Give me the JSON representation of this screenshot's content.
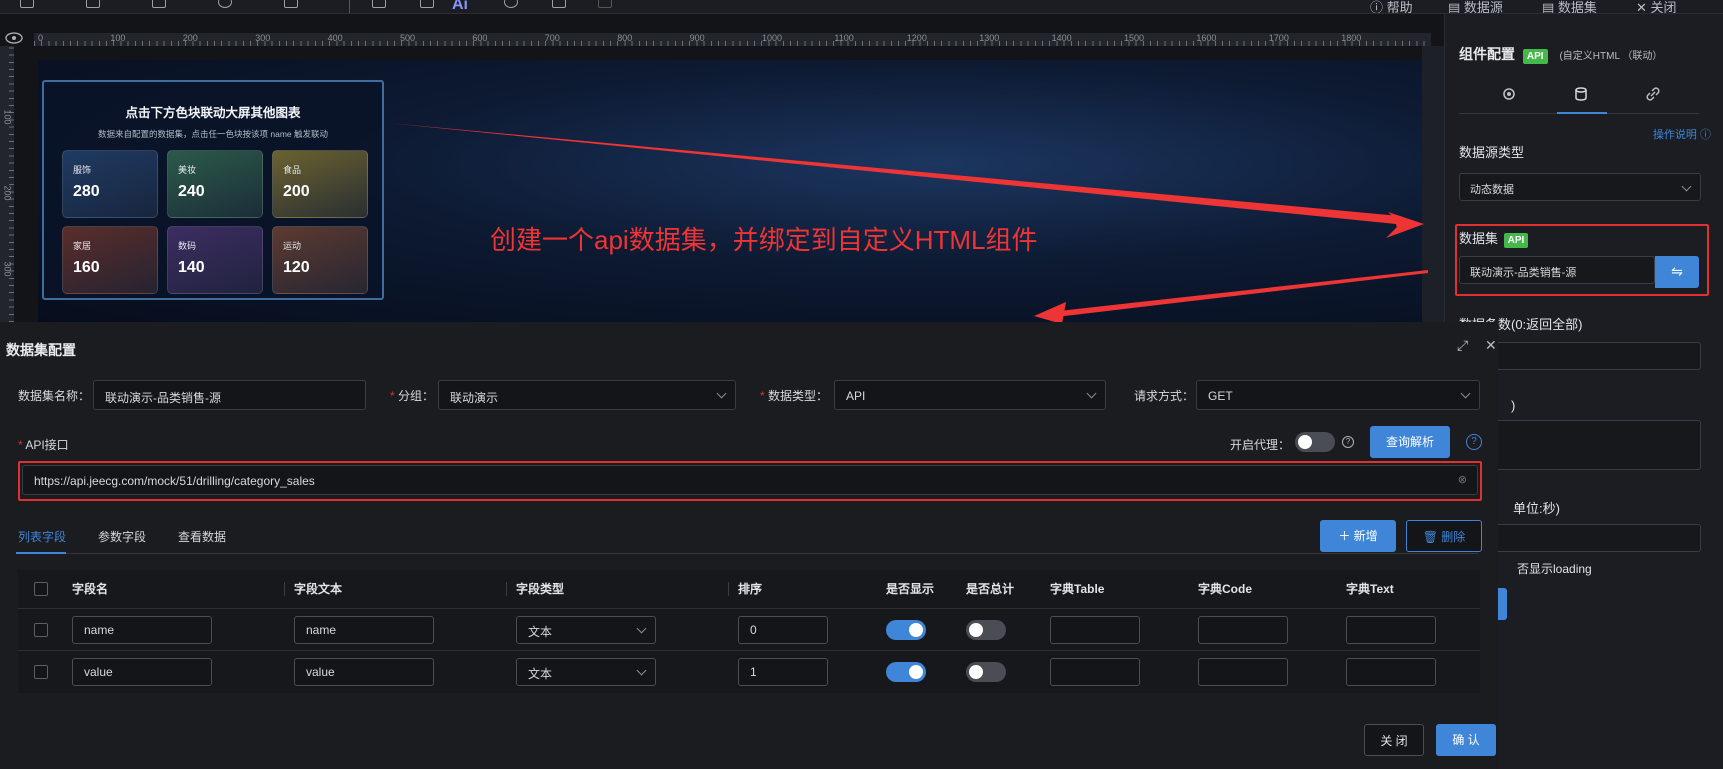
{
  "toolbar": {
    "help": "帮助",
    "datasource": "数据源",
    "dataset": "数据集",
    "close": "关闭",
    "ai_label": "Ai"
  },
  "ruler": {
    "labels": [
      "0",
      "100",
      "200",
      "300",
      "400",
      "500",
      "600",
      "700",
      "800",
      "900",
      "1000",
      "1100",
      "1200",
      "1300",
      "1400",
      "1500",
      "1600",
      "1700",
      "1800"
    ],
    "side_labels": [
      "100",
      "200",
      "300"
    ]
  },
  "card": {
    "title": "点击下方色块联动大屏其他图表",
    "subtitle": "数据来自配置的数据集，点击任一色块按该项 name 触发联动",
    "tiles": [
      {
        "name": "服饰",
        "value": "280",
        "color": "#1f3a63"
      },
      {
        "name": "美妆",
        "value": "240",
        "color": "#2c5a4a"
      },
      {
        "name": "食品",
        "value": "200",
        "color": "#6b6230"
      },
      {
        "name": "家居",
        "value": "160",
        "color": "#5a2d2a"
      },
      {
        "name": "数码",
        "value": "140",
        "color": "#3d2d62"
      },
      {
        "name": "运动",
        "value": "120",
        "color": "#5d3a30"
      }
    ]
  },
  "annotation": "创建一个api数据集，并绑定到自定义HTML组件",
  "right_panel": {
    "title": "组件配置",
    "title_badge": "API",
    "title_note": "(自定义HTML （联动）",
    "help_link": "操作说明",
    "source_type_label": "数据源类型",
    "source_type_value": "动态数据",
    "dataset_label": "数据集",
    "dataset_badge": "API",
    "dataset_value": "联动演示-品类销售-源",
    "count_label": "数据条数(0:返回全部)",
    "param_label": ")",
    "interval_label": "单位:秒)",
    "loading_label": "否显示loading"
  },
  "modal": {
    "title": "数据集配置",
    "name_label": "数据集名称：",
    "name_value": "联动演示-品类销售-源",
    "group_label": "分组：",
    "group_value": "联动演示",
    "type_label": "数据类型：",
    "type_value": "API",
    "method_label": "请求方式：",
    "method_value": "GET",
    "api_label": "API接口",
    "api_value": "https://api.jeecg.com/mock/51/drilling/category_sales",
    "proxy_label": "开启代理：",
    "parse_button": "查询解析",
    "tabs": [
      "列表字段",
      "参数字段",
      "查看数据"
    ],
    "add_button": "新增",
    "delete_button": "删除",
    "columns": [
      "字段名",
      "字段文本",
      "字段类型",
      "排序",
      "是否显示",
      "是否总计",
      "字典Table",
      "字典Code",
      "字典Text"
    ],
    "rows": [
      {
        "field": "name",
        "text": "name",
        "type": "文本",
        "order": "0",
        "show": true,
        "total": false
      },
      {
        "field": "value",
        "text": "value",
        "type": "文本",
        "order": "1",
        "show": true,
        "total": false
      }
    ],
    "close_button": "关 闭",
    "confirm_button": "确 认"
  },
  "colors": {
    "accent": "#3f86d8",
    "annotation": "#ee3434",
    "badge": "#44b84b"
  }
}
